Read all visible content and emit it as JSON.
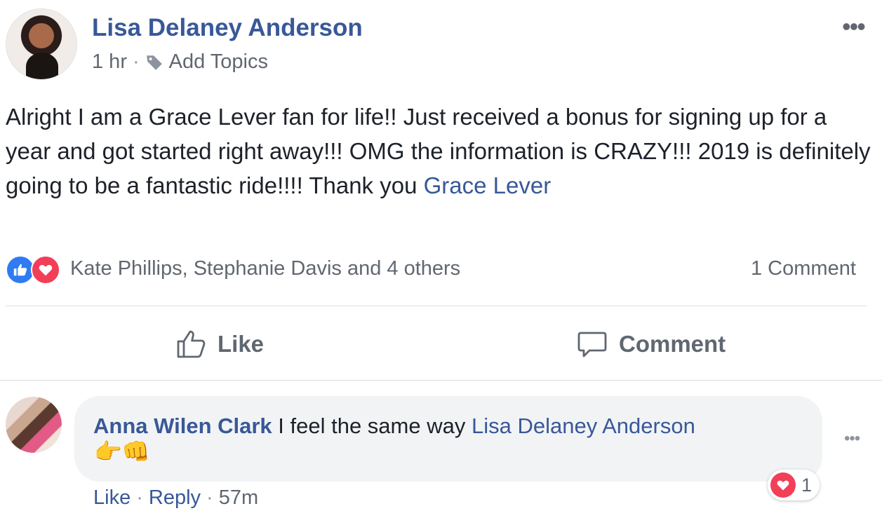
{
  "post": {
    "author": "Lisa Delaney Anderson",
    "time": "1 hr",
    "separator": "·",
    "add_topics": "Add Topics",
    "more": "•••",
    "text_main": "Alright I am a Grace Lever fan for life!! Just received a bonus for signing up for a year and got started right away!!! OMG the information is CRAZY!!! 2019 is definitely going to be a fantastic ride!!!! Thank you ",
    "text_mention": "Grace Lever",
    "icons": {
      "tag": "tag-icon",
      "more": "more-options-icon"
    }
  },
  "reactions": {
    "reactors": "Kate Phillips, Stephanie Davis and 4 others",
    "comment_count": "1 Comment",
    "types": [
      "like",
      "love"
    ]
  },
  "actions": {
    "like_label": "Like",
    "comment_label": "Comment"
  },
  "comment": {
    "author": "Anna Wilen Clark",
    "body": " I feel the same way ",
    "mention": "Lisa Delaney Anderson",
    "emojis": "👉👊",
    "more": "•••",
    "reaction_count": "1",
    "like_label": "Like",
    "reply_label": "Reply",
    "separator": "·",
    "time": "57m"
  },
  "colors": {
    "link": "#385898",
    "secondary_text": "#616770",
    "like_blue": "#2e7bf2",
    "love_red": "#f33e58",
    "bubble_bg": "#f2f3f5"
  }
}
